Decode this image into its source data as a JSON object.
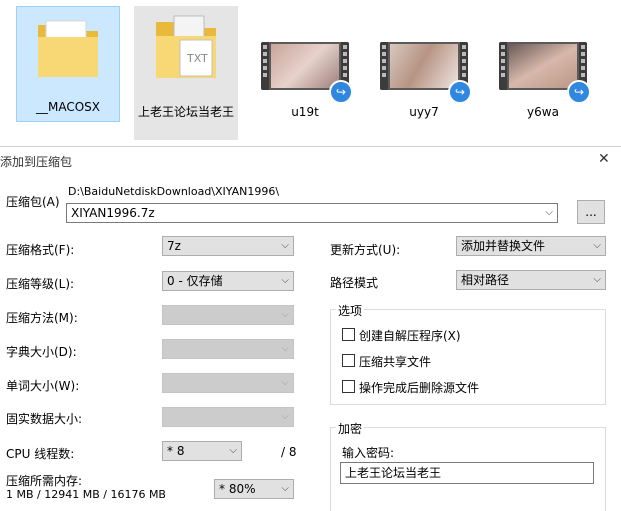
{
  "explorer": {
    "files": [
      {
        "name": "__MACOSX",
        "type": "folder"
      },
      {
        "name": "上老王论坛当老王",
        "type": "folder-txt"
      },
      {
        "name": "u19t",
        "type": "video-shortcut"
      },
      {
        "name": "uyy7",
        "type": "video-shortcut"
      },
      {
        "name": "y6wa",
        "type": "video-shortcut"
      }
    ]
  },
  "dialog": {
    "title": "添加到压缩包",
    "close_label": "✕",
    "archive_label": "压缩包(A)",
    "archive_path": "D:\\BaiduNetdiskDownload\\XIYAN1996\\",
    "archive_name": "XIYAN1996.7z",
    "browse_label": "...",
    "format_label": "压缩格式(F):",
    "format_value": "7z",
    "level_label": "压缩等级(L):",
    "level_value": "0 - 仅存储",
    "method_label": "压缩方法(M):",
    "dict_label": "字典大小(D):",
    "word_label": "单词大小(W):",
    "solid_label": "固实数据大小:",
    "cpu_label": "CPU 线程数:",
    "cpu_value": "* 8",
    "cpu_total": "/ 8",
    "mem_label": "压缩所需内存:",
    "mem_stats": "1 MB / 12941 MB / 16176 MB",
    "mem_value": "* 80%",
    "update_label": "更新方式(U):",
    "update_value": "添加并替换文件",
    "pathmode_label": "路径模式",
    "pathmode_value": "相对路径",
    "options_title": "选项",
    "opt_sfx": "创建自解压程序(X)",
    "opt_shared": "压缩共享文件",
    "opt_delete": "操作完成后删除源文件",
    "encrypt_title": "加密",
    "password_label": "输入密码:",
    "password_value": "上老王论坛当老王"
  },
  "colors": {
    "selection_bg": "#cce8ff",
    "folder_yellow": "#f8d775",
    "shortcut_blue": "#2f87e0"
  }
}
